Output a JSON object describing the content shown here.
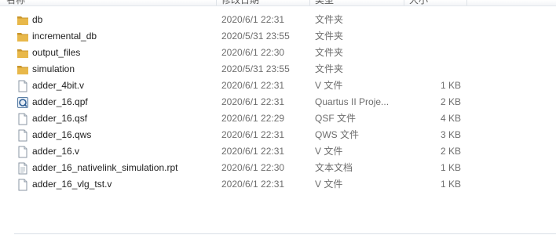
{
  "header": {
    "columns": [
      "名称",
      "修改日期",
      "类型",
      "大小"
    ]
  },
  "files": [
    {
      "name": "db",
      "date": "2020/6/1 22:31",
      "type": "文件夹",
      "size": "",
      "icon": "folder"
    },
    {
      "name": "incremental_db",
      "date": "2020/5/31 23:55",
      "type": "文件夹",
      "size": "",
      "icon": "folder"
    },
    {
      "name": "output_files",
      "date": "2020/6/1 22:30",
      "type": "文件夹",
      "size": "",
      "icon": "folder"
    },
    {
      "name": "simulation",
      "date": "2020/5/31 23:55",
      "type": "文件夹",
      "size": "",
      "icon": "folder"
    },
    {
      "name": "adder_4bit.v",
      "date": "2020/6/1 22:31",
      "type": "V 文件",
      "size": "1 KB",
      "icon": "doc"
    },
    {
      "name": "adder_16.qpf",
      "date": "2020/6/1 22:31",
      "type": "Quartus II Proje...",
      "size": "2 KB",
      "icon": "qpf"
    },
    {
      "name": "adder_16.qsf",
      "date": "2020/6/1 22:29",
      "type": "QSF 文件",
      "size": "4 KB",
      "icon": "doc"
    },
    {
      "name": "adder_16.qws",
      "date": "2020/6/1 22:31",
      "type": "QWS 文件",
      "size": "3 KB",
      "icon": "doc"
    },
    {
      "name": "adder_16.v",
      "date": "2020/6/1 22:31",
      "type": "V 文件",
      "size": "2 KB",
      "icon": "doc"
    },
    {
      "name": "adder_16_nativelink_simulation.rpt",
      "date": "2020/6/1 22:30",
      "type": "文本文档",
      "size": "1 KB",
      "icon": "text"
    },
    {
      "name": "adder_16_vlg_tst.v",
      "date": "2020/6/1 22:31",
      "type": "V 文件",
      "size": "1 KB",
      "icon": "doc"
    }
  ],
  "colors": {
    "folder": "#e8b84a",
    "folder_dark": "#c9952a",
    "secondary_text": "#6d6d6d"
  }
}
